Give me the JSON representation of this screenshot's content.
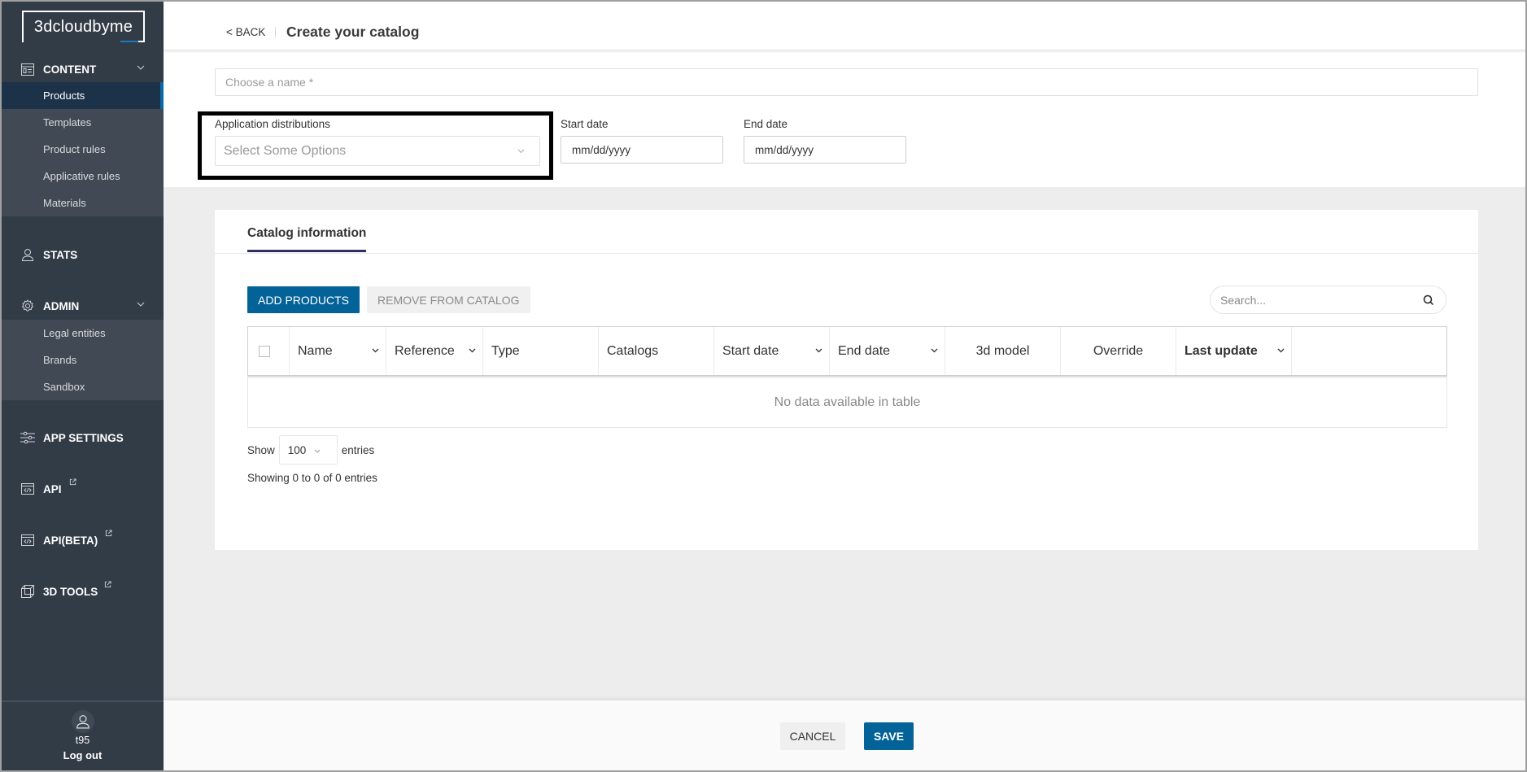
{
  "app": {
    "logo_text": "3dcloudbyme"
  },
  "sidebar": {
    "sections": [
      {
        "label": "CONTENT",
        "icon": "content-window-icon",
        "expanded": true,
        "items": [
          {
            "label": "Products",
            "active": true
          },
          {
            "label": "Templates",
            "active": false
          },
          {
            "label": "Product rules",
            "active": false
          },
          {
            "label": "Applicative rules",
            "active": false
          },
          {
            "label": "Materials",
            "active": false
          }
        ]
      },
      {
        "label": "STATS",
        "icon": "user-icon"
      },
      {
        "label": "ADMIN",
        "icon": "gear-icon",
        "expanded": true,
        "items": [
          {
            "label": "Legal entities"
          },
          {
            "label": "Brands"
          },
          {
            "label": "Sandbox"
          }
        ]
      },
      {
        "label": "APP SETTINGS",
        "icon": "sliders-icon"
      },
      {
        "label": "API",
        "icon": "code-window-icon",
        "external": true
      },
      {
        "label": "API(BETA)",
        "icon": "code-window-icon",
        "external": true
      },
      {
        "label": "3D TOOLS",
        "icon": "cube-icon",
        "external": true
      }
    ],
    "user": {
      "name": "t95",
      "logout_label": "Log out"
    }
  },
  "header": {
    "back_label": "< BACK",
    "title": "Create your catalog"
  },
  "form": {
    "name_placeholder": "Choose a name *",
    "name_value": "",
    "app_distributions": {
      "label": "Application distributions",
      "placeholder": "Select Some Options"
    },
    "start_date": {
      "label": "Start date",
      "placeholder": "mm/dd/yyyy"
    },
    "end_date": {
      "label": "End date",
      "placeholder": "mm/dd/yyyy"
    }
  },
  "panel": {
    "tab_label": "Catalog information",
    "add_button": "ADD PRODUCTS",
    "remove_button": "REMOVE FROM CATALOG",
    "search_placeholder": "Search...",
    "columns": [
      {
        "label": "Name",
        "sortable": true
      },
      {
        "label": "Reference",
        "sortable": true
      },
      {
        "label": "Type",
        "sortable": false
      },
      {
        "label": "Catalogs",
        "sortable": false
      },
      {
        "label": "Start date",
        "sortable": true
      },
      {
        "label": "End date",
        "sortable": true
      },
      {
        "label": "3d model",
        "sortable": false
      },
      {
        "label": "Override",
        "sortable": false
      },
      {
        "label": "Last update",
        "sortable": true
      }
    ],
    "empty_message": "No data available in table",
    "show_label": "Show",
    "page_length": "100",
    "entries_label": "entries",
    "info": "Showing 0 to 0 of 0 entries"
  },
  "footer": {
    "cancel_label": "CANCEL",
    "save_label": "SAVE"
  },
  "colors": {
    "primary": "#036298",
    "sidebar_bg": "#323c47",
    "sidebar_active": "#1c3249",
    "tab_underline": "#2d2f5e"
  }
}
